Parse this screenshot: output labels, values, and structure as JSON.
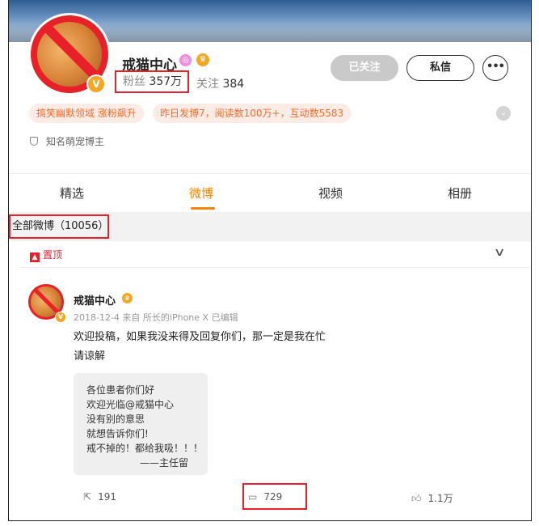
{
  "profile": {
    "name": "戒猫中心",
    "fans_label": "粉丝",
    "fans_value": "357万",
    "following_label": "关注",
    "following_value": "384",
    "verified_icon": "v-badge-icon",
    "description": "知名萌宠博主"
  },
  "buttons": {
    "followed": "已关注",
    "message": "私信",
    "more": "•••"
  },
  "tags": [
    "搞笑幽默领域 涨粉飙升",
    "昨日发博7，阅读数100万+，互动数5583"
  ],
  "tabs": [
    {
      "label": "精选",
      "active": false
    },
    {
      "label": "微博",
      "active": true
    },
    {
      "label": "视频",
      "active": false
    },
    {
      "label": "相册",
      "active": false
    }
  ],
  "feed": {
    "all_label": "全部微博（10056）",
    "pinned_label": "置顶"
  },
  "post": {
    "author": "戒猫中心",
    "meta": "2018-12-4 来自 所长的iPhone X 已编辑",
    "text_line1": "欢迎投稿，如果我没来得及回复你们，那一定是我在忙",
    "text_line2": "请谅解",
    "image_lines": [
      "各位患者你们好",
      "欢迎光临@戒猫中心",
      "没有别的意思",
      "就想告诉你们!",
      "戒不掉的！都给我吸！！！",
      "——主任留"
    ],
    "repost_count": "191",
    "comment_count": "729",
    "like_count": "1.1万"
  },
  "colors": {
    "accent": "#ff8200",
    "highlight_box": "#e8202a",
    "tag_text": "#ff6a2a",
    "tag_bg": "#fdece5"
  }
}
